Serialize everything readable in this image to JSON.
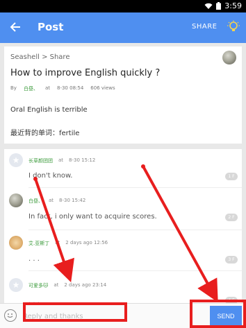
{
  "status_bar": {
    "time": "3:59"
  },
  "app_bar": {
    "title": "Post",
    "share_label": "SHARE",
    "back_icon": "back-arrow-icon",
    "bulb_icon": "lightbulb-icon"
  },
  "post": {
    "breadcrumb": "Seashell > Share",
    "title": "How to improve English quickly ?",
    "by_label": "By",
    "author": "白昼、",
    "at_label": "at",
    "datetime": "8-30 08:54",
    "views": "606 views",
    "body_line1": "Oral English is terrible",
    "body_line2": "最近背的单词：fertile"
  },
  "comments": [
    {
      "author": "长草颜团团",
      "at": "at",
      "time": "8-30 15:12",
      "text": "I don't know.",
      "floor": "1 F"
    },
    {
      "author": "白昼、",
      "at": "at",
      "time": "8-30 15:42",
      "text": "In fact, i only want to acquire scores.",
      "floor": "2 F"
    },
    {
      "author": "艾.亚斯丁",
      "at": "at",
      "time": "2 days ago 12:56",
      "text": ". . .",
      "floor": "3 F"
    },
    {
      "author": "可爱多🐱",
      "at": "at",
      "time": "2 days ago 23:14",
      "text": ". . .",
      "floor": "4 F"
    }
  ],
  "reply": {
    "placeholder": "Reply and thanks",
    "send_label": "SEND"
  },
  "colors": {
    "primary": "#4f8ff0",
    "author_green": "#3a9a3a",
    "annotation_red": "#e81e1e"
  }
}
